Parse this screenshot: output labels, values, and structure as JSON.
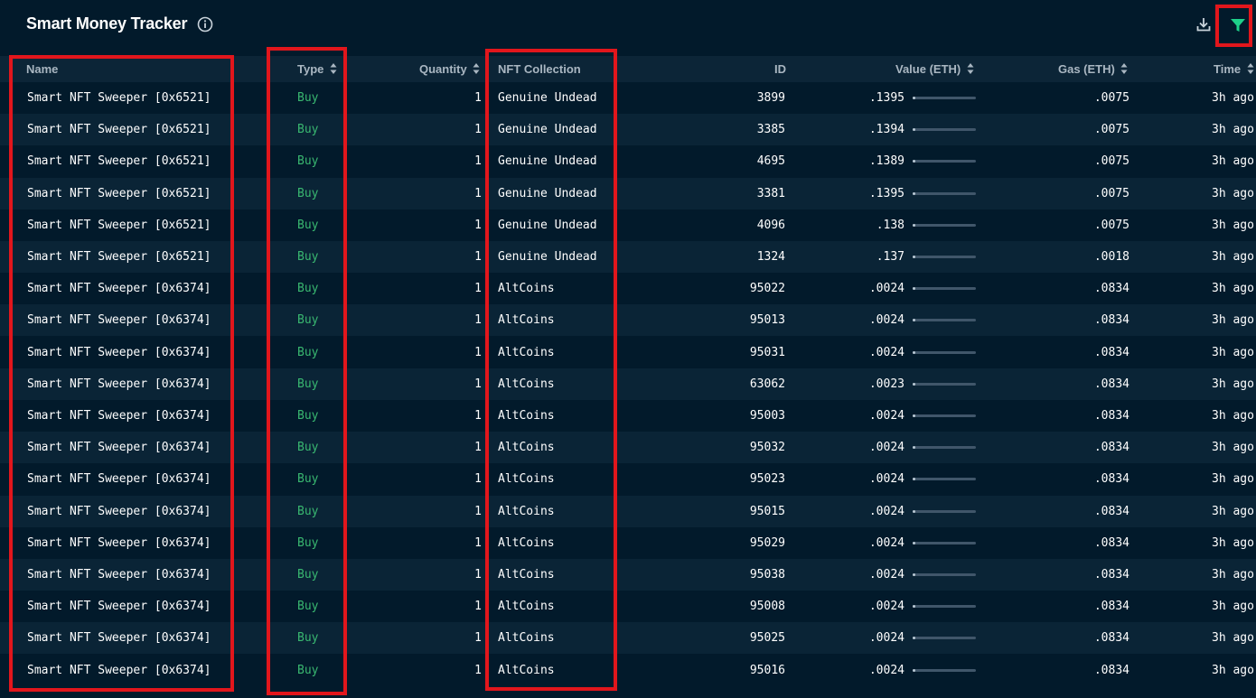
{
  "header": {
    "title": "Smart Money Tracker",
    "info_icon": "info-icon",
    "download_icon": "download-icon",
    "filter_icon": "filter-icon"
  },
  "colors": {
    "background": "#021a2b",
    "header_row": "#0c2537",
    "alt_row": "#0a2436",
    "buy_green": "#39b770",
    "filter_green": "#1ed08a",
    "highlight_red": "#e2161c"
  },
  "columns": {
    "name": "Name",
    "type": "Type",
    "quantity": "Quantity",
    "collection": "NFT Collection",
    "id": "ID",
    "value": "Value (ETH)",
    "gas": "Gas (ETH)",
    "time": "Time"
  },
  "rows": [
    {
      "name": "Smart NFT Sweeper [0x6521]",
      "type": "Buy",
      "quantity": "1",
      "collection": "Genuine Undead",
      "id": "3899",
      "value": ".1395",
      "gas": ".0075",
      "time": "3h ago"
    },
    {
      "name": "Smart NFT Sweeper [0x6521]",
      "type": "Buy",
      "quantity": "1",
      "collection": "Genuine Undead",
      "id": "3385",
      "value": ".1394",
      "gas": ".0075",
      "time": "3h ago"
    },
    {
      "name": "Smart NFT Sweeper [0x6521]",
      "type": "Buy",
      "quantity": "1",
      "collection": "Genuine Undead",
      "id": "4695",
      "value": ".1389",
      "gas": ".0075",
      "time": "3h ago"
    },
    {
      "name": "Smart NFT Sweeper [0x6521]",
      "type": "Buy",
      "quantity": "1",
      "collection": "Genuine Undead",
      "id": "3381",
      "value": ".1395",
      "gas": ".0075",
      "time": "3h ago"
    },
    {
      "name": "Smart NFT Sweeper [0x6521]",
      "type": "Buy",
      "quantity": "1",
      "collection": "Genuine Undead",
      "id": "4096",
      "value": ".138",
      "gas": ".0075",
      "time": "3h ago"
    },
    {
      "name": "Smart NFT Sweeper [0x6521]",
      "type": "Buy",
      "quantity": "1",
      "collection": "Genuine Undead",
      "id": "1324",
      "value": ".137",
      "gas": ".0018",
      "time": "3h ago"
    },
    {
      "name": "Smart NFT Sweeper [0x6374]",
      "type": "Buy",
      "quantity": "1",
      "collection": "AltCoins",
      "id": "95022",
      "value": ".0024",
      "gas": ".0834",
      "time": "3h ago"
    },
    {
      "name": "Smart NFT Sweeper [0x6374]",
      "type": "Buy",
      "quantity": "1",
      "collection": "AltCoins",
      "id": "95013",
      "value": ".0024",
      "gas": ".0834",
      "time": "3h ago"
    },
    {
      "name": "Smart NFT Sweeper [0x6374]",
      "type": "Buy",
      "quantity": "1",
      "collection": "AltCoins",
      "id": "95031",
      "value": ".0024",
      "gas": ".0834",
      "time": "3h ago"
    },
    {
      "name": "Smart NFT Sweeper [0x6374]",
      "type": "Buy",
      "quantity": "1",
      "collection": "AltCoins",
      "id": "63062",
      "value": ".0023",
      "gas": ".0834",
      "time": "3h ago"
    },
    {
      "name": "Smart NFT Sweeper [0x6374]",
      "type": "Buy",
      "quantity": "1",
      "collection": "AltCoins",
      "id": "95003",
      "value": ".0024",
      "gas": ".0834",
      "time": "3h ago"
    },
    {
      "name": "Smart NFT Sweeper [0x6374]",
      "type": "Buy",
      "quantity": "1",
      "collection": "AltCoins",
      "id": "95032",
      "value": ".0024",
      "gas": ".0834",
      "time": "3h ago"
    },
    {
      "name": "Smart NFT Sweeper [0x6374]",
      "type": "Buy",
      "quantity": "1",
      "collection": "AltCoins",
      "id": "95023",
      "value": ".0024",
      "gas": ".0834",
      "time": "3h ago"
    },
    {
      "name": "Smart NFT Sweeper [0x6374]",
      "type": "Buy",
      "quantity": "1",
      "collection": "AltCoins",
      "id": "95015",
      "value": ".0024",
      "gas": ".0834",
      "time": "3h ago"
    },
    {
      "name": "Smart NFT Sweeper [0x6374]",
      "type": "Buy",
      "quantity": "1",
      "collection": "AltCoins",
      "id": "95029",
      "value": ".0024",
      "gas": ".0834",
      "time": "3h ago"
    },
    {
      "name": "Smart NFT Sweeper [0x6374]",
      "type": "Buy",
      "quantity": "1",
      "collection": "AltCoins",
      "id": "95038",
      "value": ".0024",
      "gas": ".0834",
      "time": "3h ago"
    },
    {
      "name": "Smart NFT Sweeper [0x6374]",
      "type": "Buy",
      "quantity": "1",
      "collection": "AltCoins",
      "id": "95008",
      "value": ".0024",
      "gas": ".0834",
      "time": "3h ago"
    },
    {
      "name": "Smart NFT Sweeper [0x6374]",
      "type": "Buy",
      "quantity": "1",
      "collection": "AltCoins",
      "id": "95025",
      "value": ".0024",
      "gas": ".0834",
      "time": "3h ago"
    },
    {
      "name": "Smart NFT Sweeper [0x6374]",
      "type": "Buy",
      "quantity": "1",
      "collection": "AltCoins",
      "id": "95016",
      "value": ".0024",
      "gas": ".0834",
      "time": "3h ago"
    }
  ]
}
